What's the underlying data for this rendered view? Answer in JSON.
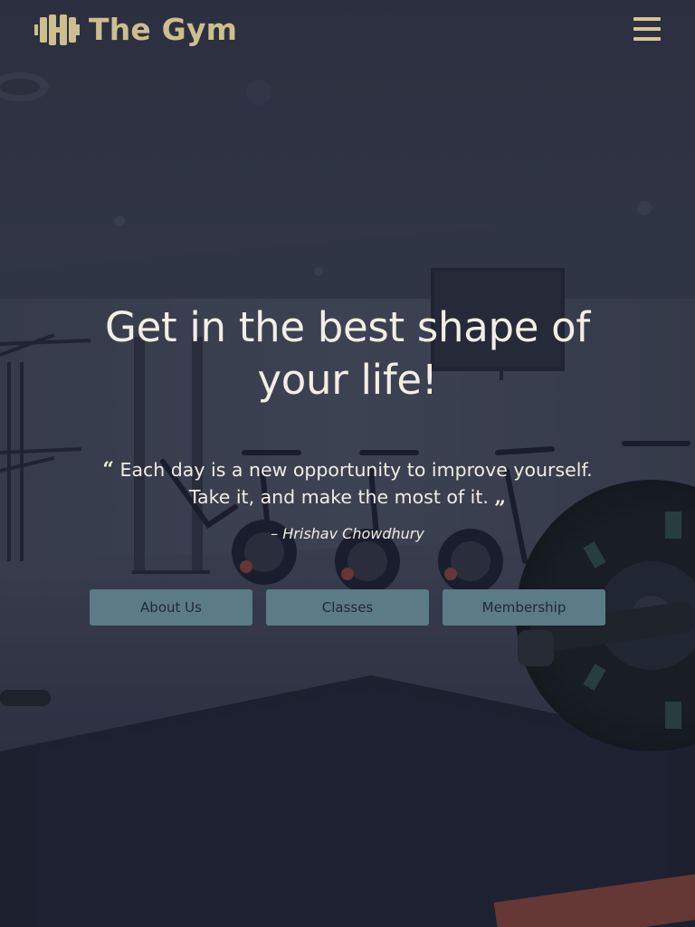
{
  "header": {
    "brand_name": "The Gym",
    "brand_icon": "dumbbell-icon",
    "menu_icon": "hamburger-menu-icon"
  },
  "hero": {
    "headline": "Get in the best shape of your life!",
    "quote_open": "“",
    "quote_text": " Each day is a new opportunity to improve yourself. Take it, and make the most of it. ",
    "quote_close": "„",
    "quote_author": "– Hrishav Chowdhury",
    "buttons": [
      {
        "label": "About Us"
      },
      {
        "label": "Classes"
      },
      {
        "label": "Membership"
      }
    ]
  },
  "colors": {
    "brand_accent": "#cdbe8d",
    "overlay": "#262a38",
    "button_bg": "#5b7b85",
    "button_text": "#1f2a33",
    "hero_text": "#f1ece2"
  }
}
